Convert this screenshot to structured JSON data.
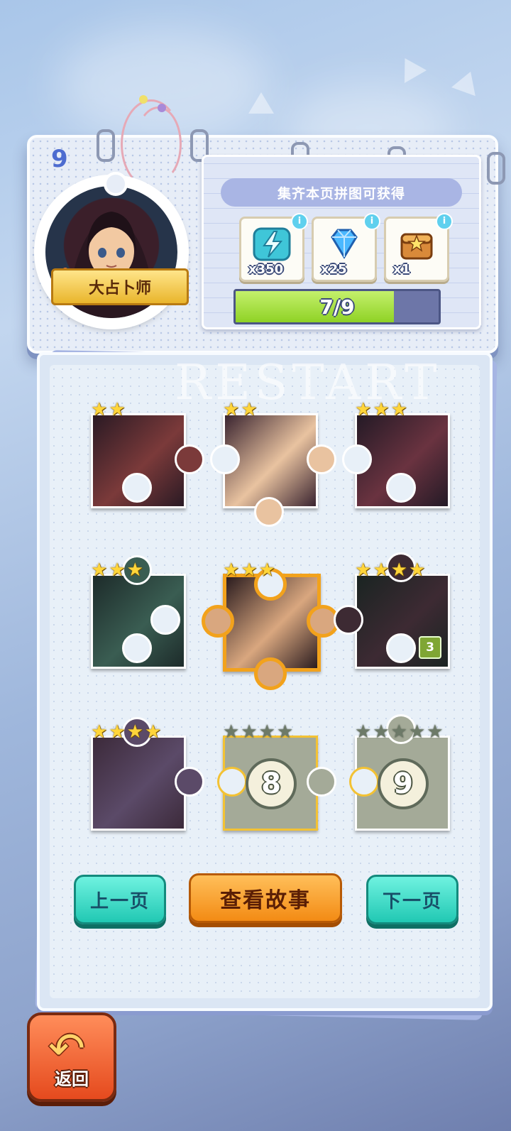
{
  "album": {
    "page_number": "9",
    "character_name": "大占卜师"
  },
  "reward": {
    "title": "集齐本页拼图可获得",
    "items": [
      {
        "icon": "lightning-energy-icon",
        "qty": "x350"
      },
      {
        "icon": "blue-diamond-icon",
        "qty": "x25"
      },
      {
        "icon": "treasure-chest-icon",
        "qty": "x1"
      }
    ],
    "info_symbol": "i",
    "progress_text": "7/9",
    "progress_value": 0.78
  },
  "watermark": "RESTART",
  "pieces": [
    {
      "id": 1,
      "stars": 2,
      "collected": true,
      "count": ""
    },
    {
      "id": 2,
      "stars": 2,
      "collected": true,
      "count": ""
    },
    {
      "id": 3,
      "stars": 3,
      "collected": true,
      "count": ""
    },
    {
      "id": 4,
      "stars": 3,
      "collected": true,
      "count": ""
    },
    {
      "id": 5,
      "stars": 3,
      "collected": true,
      "count": "",
      "selected": true
    },
    {
      "id": 6,
      "stars": 4,
      "collected": true,
      "count": "3"
    },
    {
      "id": 7,
      "stars": 4,
      "collected": true,
      "count": ""
    },
    {
      "id": 8,
      "stars": 4,
      "collected": false,
      "count": "",
      "label": "8"
    },
    {
      "id": 9,
      "stars": 5,
      "collected": false,
      "count": "",
      "label": "9"
    }
  ],
  "buttons": {
    "prev": "上一页",
    "story": "查看故事",
    "next": "下一页",
    "back": "返回"
  },
  "colors": {
    "accent_teal": "#21c8b3",
    "accent_orange": "#f38b14",
    "progress_green": "#8fd225",
    "star_gold": "#ffd53a"
  }
}
